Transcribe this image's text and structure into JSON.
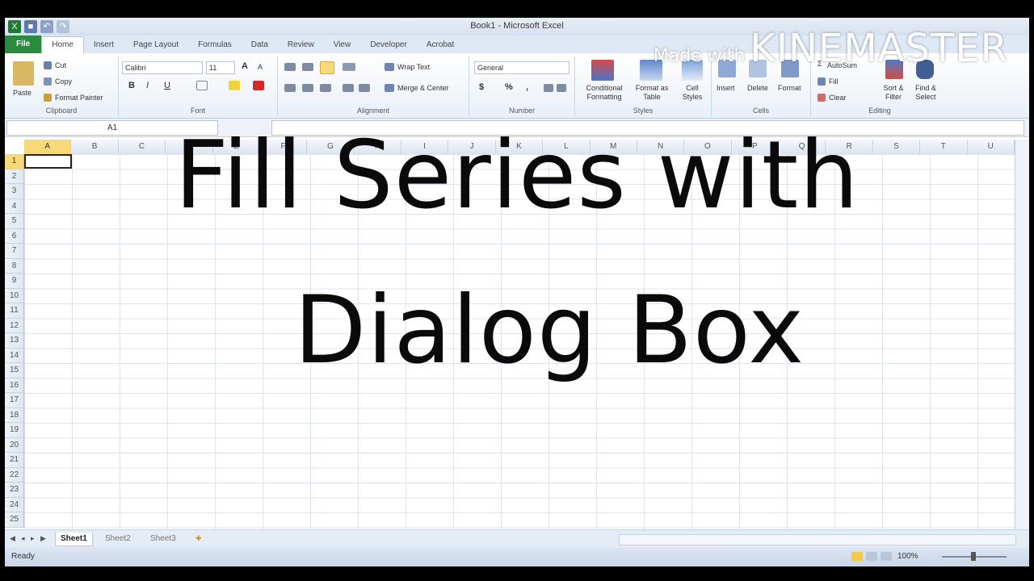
{
  "window": {
    "title": "Book1 - Microsoft Excel"
  },
  "tabs": [
    "File",
    "Home",
    "Insert",
    "Page Layout",
    "Formulas",
    "Data",
    "Review",
    "View",
    "Developer",
    "Acrobat"
  ],
  "ribbon": {
    "clipboard": {
      "paste": "Paste",
      "cut": "Cut",
      "copy": "Copy",
      "format_painter": "Format Painter",
      "label": "Clipboard"
    },
    "font": {
      "name": "Calibri",
      "size": "11",
      "bold": "B",
      "italic": "I",
      "underline": "U",
      "grow": "A",
      "shrink": "A",
      "label": "Font"
    },
    "alignment": {
      "wrap_text": "Wrap Text",
      "merge_center": "Merge & Center",
      "label": "Alignment"
    },
    "number": {
      "format": "General",
      "currency": "$",
      "percent": "%",
      "comma": ",",
      "label": "Number"
    },
    "styles": {
      "conditional": "Conditional Formatting",
      "format_table": "Format as Table",
      "cell_styles": "Cell Styles",
      "label": "Styles"
    },
    "cells": {
      "insert": "Insert",
      "delete": "Delete",
      "format": "Format",
      "label": "Cells"
    },
    "editing": {
      "autosum": "AutoSum",
      "fill": "Fill",
      "clear": "Clear",
      "sort": "Sort & Filter",
      "find": "Find & Select",
      "label": "Editing"
    }
  },
  "formula_bar": {
    "name_box": "A1"
  },
  "columns": [
    "A",
    "B",
    "C",
    "D",
    "E",
    "F",
    "G",
    "H",
    "I",
    "J",
    "K",
    "L",
    "M",
    "N",
    "O",
    "P",
    "Q",
    "R",
    "S",
    "T",
    "U"
  ],
  "rows": [
    "1",
    "2",
    "3",
    "4",
    "5",
    "6",
    "7",
    "8",
    "9",
    "10",
    "11",
    "12",
    "13",
    "14",
    "15",
    "16",
    "17",
    "18",
    "19",
    "20",
    "21",
    "22",
    "23",
    "24",
    "25"
  ],
  "sheets": [
    "Sheet1",
    "Sheet2",
    "Sheet3"
  ],
  "status": {
    "ready": "Ready",
    "zoom": "100%"
  },
  "overlay": {
    "line1": "Fill Series with",
    "line2": "Dialog Box"
  },
  "watermark": {
    "prefix": "Made with",
    "brand": "KINEMASTER"
  },
  "colors": {
    "file_tab": "#2a8a3e",
    "selection": "#f7d97a"
  }
}
